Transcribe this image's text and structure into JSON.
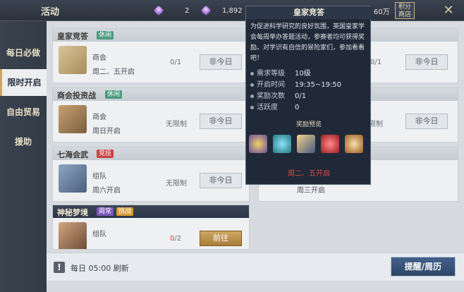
{
  "header": {
    "title": "活动",
    "gems": "2",
    "coins": "1,892",
    "money": "60万",
    "shop_label": "积分\n商店"
  },
  "sidebar": {
    "items": [
      {
        "label": "每日必做"
      },
      {
        "label": "限时开启"
      },
      {
        "label": "自由贸易"
      },
      {
        "label": "援助"
      }
    ]
  },
  "cards": [
    {
      "name": "皇家竞答",
      "tag": "休闲",
      "line1": "商会",
      "line2": "周二、五开启",
      "count": "0/1",
      "button": "非今日"
    },
    {
      "name": "商会投资战",
      "tag": "休闲",
      "line1": "商会",
      "line2": "周日开启",
      "count": "无限制",
      "button": "非今日"
    },
    {
      "name": "七海会武",
      "tag": "竞技",
      "line1": "组队",
      "line2": "周六开启",
      "count": "无限制",
      "button": "非今日"
    },
    {
      "name": "神秘梦境",
      "tag": "周常",
      "tag2": "挑战",
      "line1": "组队",
      "count_zero": "0",
      "count_rest": "/2",
      "button": "前往"
    }
  ],
  "right_col": {
    "counts": [
      "0/1",
      "无限制"
    ],
    "buttons": [
      "非今日",
      "非今日"
    ],
    "line": "周三开启"
  },
  "footer": {
    "refresh": "每日 05:00 刷新",
    "remind_label": "提醒/周历"
  },
  "popup": {
    "title": "皇家竞答",
    "desc": "为促进科学研究的良好氛围，英国皇家学会每周举办答题活动，参赛者均可获得奖励。对学识有自信的冒险家们，参加看看吧！",
    "info": [
      {
        "k": "需求等级",
        "v": "10级"
      },
      {
        "k": "开启时间",
        "v": "19:35~19:50"
      },
      {
        "k": "奖励次数",
        "v": "0/1"
      },
      {
        "k": "活跃度",
        "v": "0"
      }
    ],
    "reward_title": "奖励预览",
    "footer": "周二、五开启"
  },
  "colors": {
    "accent": "#c9a85c",
    "tag_green": "#4c9b7f",
    "tag_red": "#c94343",
    "warn_red": "#e04848"
  }
}
